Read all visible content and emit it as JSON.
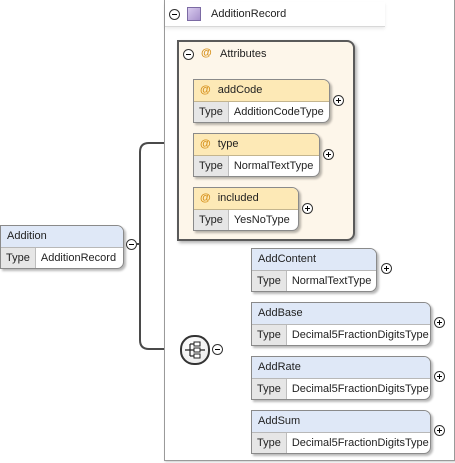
{
  "root": {
    "name": "Addition",
    "type_key": "Type",
    "type_value": "AdditionRecord"
  },
  "complex_type": {
    "name": "AdditionRecord",
    "icon": "complex-type-icon"
  },
  "attributes_group": {
    "label": "Attributes",
    "icon": "at-sign-icon",
    "items": [
      {
        "name": "addCode",
        "type_key": "Type",
        "type_value": "AdditionCodeType"
      },
      {
        "name": "type",
        "type_key": "Type",
        "type_value": "NormalTextType"
      },
      {
        "name": "included",
        "type_key": "Type",
        "type_value": "YesNoType"
      }
    ]
  },
  "sequence": {
    "icon": "sequence-compositor-icon",
    "children": [
      {
        "name": "AddContent",
        "type_key": "Type",
        "type_value": "NormalTextType"
      },
      {
        "name": "AddBase",
        "type_key": "Type",
        "type_value": "Decimal5FractionDigitsType"
      },
      {
        "name": "AddRate",
        "type_key": "Type",
        "type_value": "Decimal5FractionDigitsType"
      },
      {
        "name": "AddSum",
        "type_key": "Type",
        "type_value": "Decimal5FractionDigitsType"
      }
    ]
  },
  "colors": {
    "element_header": "#dfe8f7",
    "attribute_header": "#fde9b6",
    "attributes_box": "#fdf6ea",
    "type_key_bg": "#e6e6e6",
    "connector": "#4a4a4a",
    "border": "#8a8a8a"
  }
}
